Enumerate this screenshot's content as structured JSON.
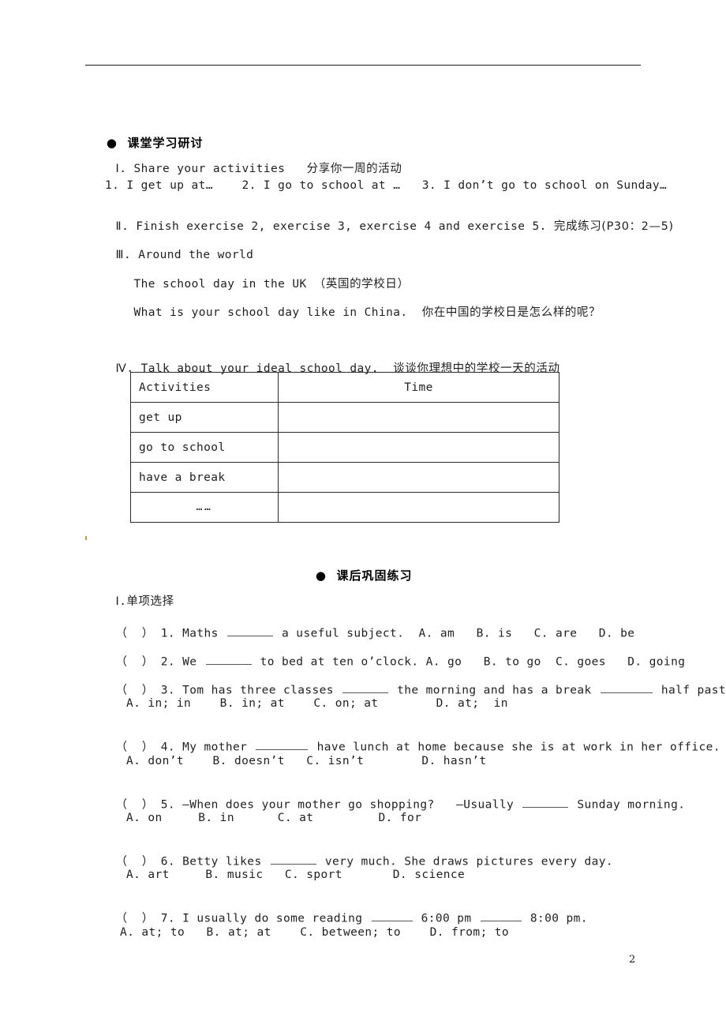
{
  "document": {
    "page_number": "2",
    "header_rule": true
  },
  "section_classwork": {
    "bullet": "●",
    "heading": "课堂学习研讨",
    "item1": {
      "numeral": "Ⅰ",
      "dot": ".",
      "en": "Share your activities",
      "zh": "分享你一周的活动",
      "examples": "1. I get up at…    2. I go to school at …   3. I don’t go to school on Sunday…"
    },
    "item2": {
      "numeral": "Ⅱ",
      "dot": ".",
      "en": "Finish exercise 2, exercise 3, exercise 4 and exercise 5.",
      "zh": "完成练习(P30：2—5)"
    },
    "item3": {
      "numeral": "Ⅲ",
      "dot": ".",
      "en": "Around the world",
      "sub1_en": "The school day in the UK ",
      "sub1_zh": "（英国的学校日）",
      "sub2_en": "What is your school day like in China.  ",
      "sub2_zh": "你在中国的学校日是怎么样的呢？"
    },
    "item4": {
      "numeral": "Ⅳ",
      "dot": ".",
      "en": "Talk about your ideal school day.  ",
      "zh": "谈谈你理想中的学校一天的活动"
    }
  },
  "ideal_day_table": {
    "headers": [
      "Activities",
      "Time"
    ],
    "rows": [
      [
        "get up",
        ""
      ],
      [
        "go to school",
        ""
      ],
      [
        "have a break",
        ""
      ],
      [
        "……",
        ""
      ]
    ]
  },
  "section_homework": {
    "bullet": "●",
    "heading": "课后巩固练习",
    "part1": {
      "numeral": "Ⅰ",
      "dot": ".",
      "zh": "单项选择"
    },
    "questions": [
      {
        "bracket": "（  ）",
        "number": "1.",
        "stem_before": "Maths ",
        "stem_after": " a useful subject.  ",
        "options_inline": "A. am   B. is   C. are   D. be",
        "options_second_line": null
      },
      {
        "bracket": "（  ）",
        "number": "2.",
        "stem_before": "We ",
        "stem_after": " to bed at ten o’clock. ",
        "options_inline": "A. go   B. to go  C. goes   D. going",
        "options_second_line": null
      },
      {
        "bracket": "（  ）",
        "number": "3.",
        "stem_before": "Tom has three classes ",
        "stem_mid": " the morning and has a break ",
        "stem_after": " half past seven.",
        "options_second_line": "A. in; in    B. in; at    C. on; at        D. at;  in"
      },
      {
        "bracket": "（  ）",
        "number": "4.",
        "stem_before": "My mother ",
        "stem_after": " have lunch at home because she is at work in her office.",
        "options_second_line": "A. don’t    B. doesn’t   C. isn’t        D. hasn’t"
      },
      {
        "bracket": "（  ）",
        "number": "5.",
        "stem_before": "—When does your mother go shopping?   —Usually ",
        "stem_after": " Sunday morning.",
        "options_second_line": "A. on     B. in      C. at         D. for"
      },
      {
        "bracket": "（  ）",
        "number": "6.",
        "stem_before": "Betty likes ",
        "stem_after": " very much. She draws pictures every day.",
        "options_second_line": "A. art     B. music   C. sport       D. science"
      },
      {
        "bracket": "（  ）",
        "number": "7.",
        "stem_before": "I usually do some reading ",
        "stem_mid": " 6:00 pm ",
        "stem_after": " 8:00 pm.",
        "options_second_line": "A. at; to   B. at; at    C. between; to    D. from; to"
      }
    ]
  }
}
